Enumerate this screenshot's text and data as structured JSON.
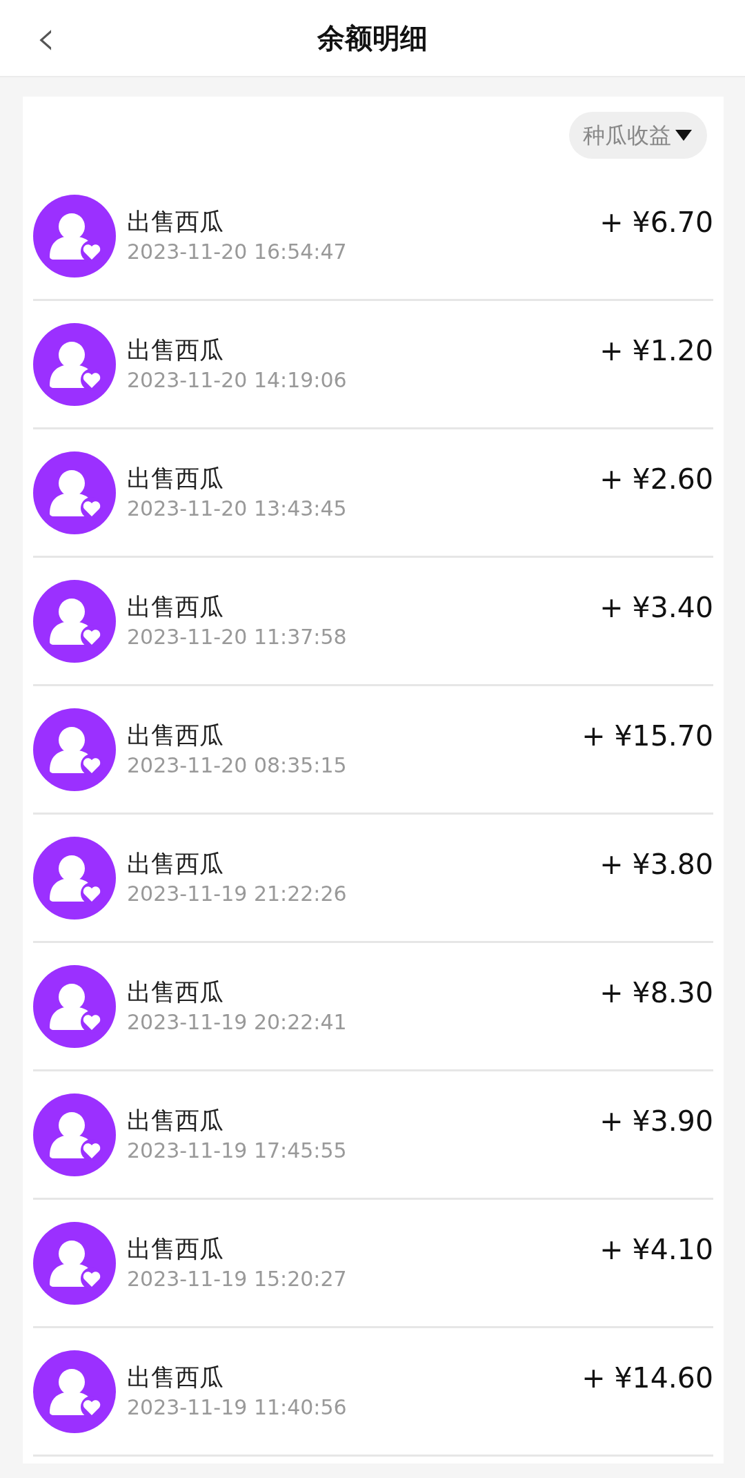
{
  "header": {
    "back": "‹",
    "title": "余额明细"
  },
  "filter": {
    "label": "种瓜收益"
  },
  "records": [
    {
      "title": "出售西瓜",
      "time": "2023-11-20 16:54:47",
      "amount": "+ ¥6.70"
    },
    {
      "title": "出售西瓜",
      "time": "2023-11-20 14:19:06",
      "amount": "+ ¥1.20"
    },
    {
      "title": "出售西瓜",
      "time": "2023-11-20 13:43:45",
      "amount": "+ ¥2.60"
    },
    {
      "title": "出售西瓜",
      "time": "2023-11-20 11:37:58",
      "amount": "+ ¥3.40"
    },
    {
      "title": "出售西瓜",
      "time": "2023-11-20 08:35:15",
      "amount": "+ ¥15.70"
    },
    {
      "title": "出售西瓜",
      "time": "2023-11-19 21:22:26",
      "amount": "+ ¥3.80"
    },
    {
      "title": "出售西瓜",
      "time": "2023-11-19 20:22:41",
      "amount": "+ ¥8.30"
    },
    {
      "title": "出售西瓜",
      "time": "2023-11-19 17:45:55",
      "amount": "+ ¥3.90"
    },
    {
      "title": "出售西瓜",
      "time": "2023-11-19 15:20:27",
      "amount": "+ ¥4.10"
    },
    {
      "title": "出售西瓜",
      "time": "2023-11-19 11:40:56",
      "amount": "+ ¥14.60"
    }
  ]
}
